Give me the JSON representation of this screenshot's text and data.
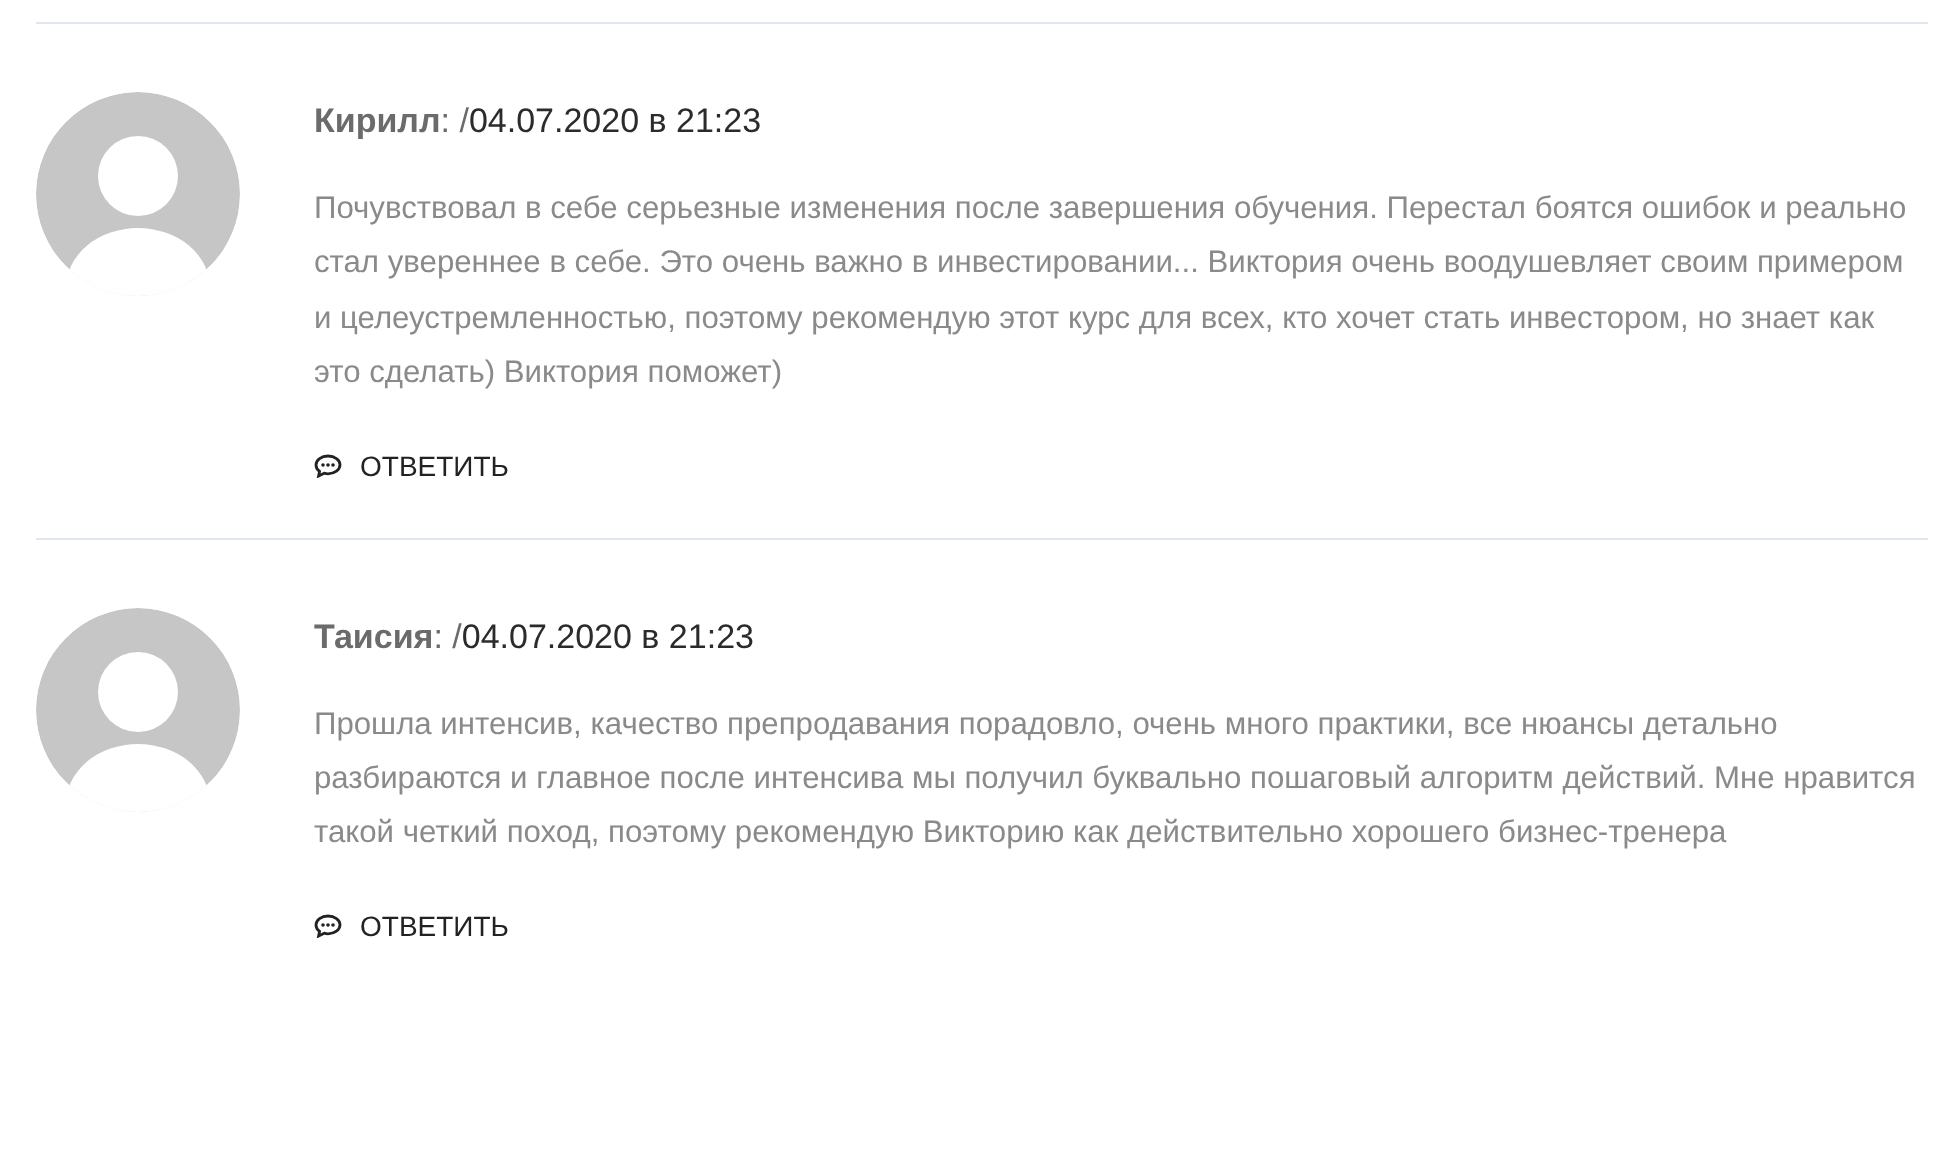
{
  "comments": [
    {
      "author": "Кирилл",
      "separator": ": /",
      "date": "04.07.2020 в 21:23",
      "text": "Почувствовал в себе серьезные изменения после завершения обучения. Перестал боятся ошибок и реально стал увереннее в себе. Это очень важно в инвестировании... Виктория очень воодушевляет своим примером и целеустремленностью, поэтому рекомендую этот курс для всех, кто хочет стать инвестором, но знает как это сделать) Виктория поможет)",
      "reply": "ОТВЕТИТЬ"
    },
    {
      "author": "Таисия",
      "separator": ": /",
      "date": "04.07.2020 в 21:23",
      "text": "Прошла интенсив, качество препродавания порадовло, очень много практики, все нюансы детально разбираются и главное после интенсива мы получил буквально пошаговый алгоритм действий. Мне нравится такой четкий поход, поэтому рекомендую Викторию как действительно хорошего бизнес-тренера",
      "reply": "ОТВЕТИТЬ"
    }
  ]
}
